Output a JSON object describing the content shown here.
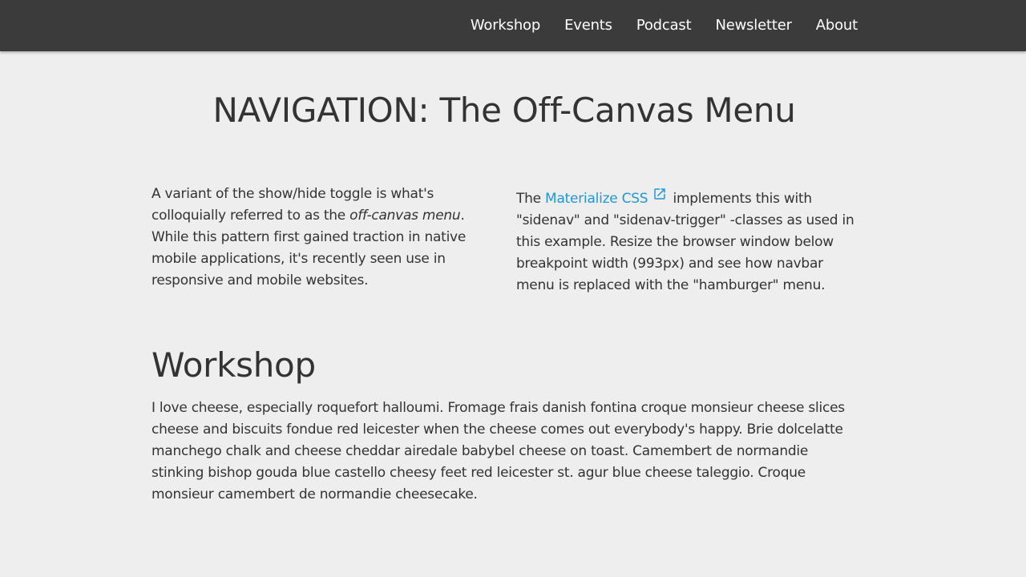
{
  "nav": {
    "items": [
      {
        "label": "Workshop"
      },
      {
        "label": "Events"
      },
      {
        "label": "Podcast"
      },
      {
        "label": "Newsletter"
      },
      {
        "label": "About"
      }
    ]
  },
  "page": {
    "title": "NAVIGATION: The Off-Canvas Menu"
  },
  "intro_left": {
    "text_before": "A variant of the show/hide toggle is what's colloquially referred to as the ",
    "emphasis": "off-canvas menu",
    "text_after": ". While this pattern first gained traction in native mobile applications, it's recently seen use in responsive and mobile websites."
  },
  "intro_right": {
    "text_before": "The ",
    "link_label": "Materialize CSS",
    "link_icon": "external-link-icon",
    "text_after": " implements this with \"sidenav\" and \"sidenav-trigger\" -classes as used in this example. Resize the browser window below breakpoint width (993px) and see how navbar menu is replaced with the \"hamburger\" menu."
  },
  "section": {
    "title": "Workshop",
    "body": "I love cheese, especially roquefort halloumi. Fromage frais danish fontina croque monsieur cheese slices cheese and biscuits fondue red leicester when the cheese comes out everybody's happy. Brie dolcelatte manchego chalk and cheese cheddar airedale babybel cheese on toast. Camembert de normandie stinking bishop gouda blue castello cheesy feet red leicester st. agur blue cheese taleggio. Croque monsieur camembert de normandie cheesecake."
  },
  "colors": {
    "navbar_bg": "#3b3b3b",
    "page_bg": "#eeeeee",
    "text": "#333333",
    "link": "#2196d9"
  }
}
